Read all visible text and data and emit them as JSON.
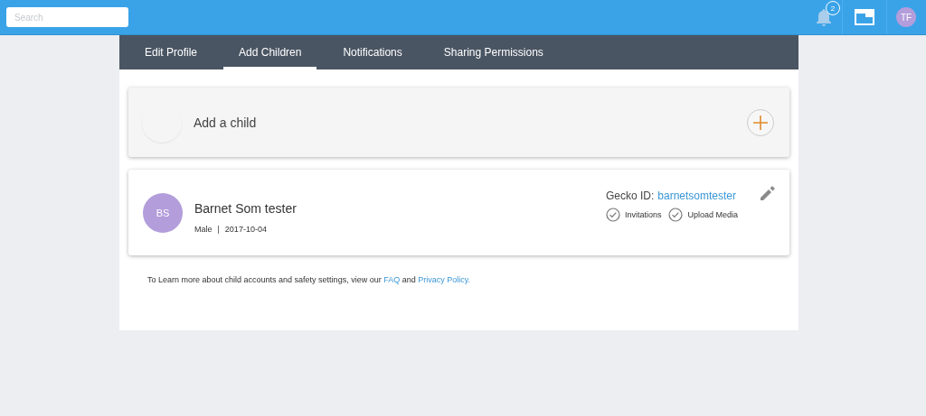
{
  "top_bar": {
    "search": {
      "placeholder": "Search"
    },
    "notifications": {
      "count": "2"
    },
    "user": {
      "initials": "TF"
    }
  },
  "tabs": [
    {
      "label": "Edit Profile",
      "selected": false
    },
    {
      "label": "Add Children",
      "selected": true
    },
    {
      "label": "Notifications",
      "selected": false
    },
    {
      "label": "Sharing Permissions",
      "selected": false
    }
  ],
  "add_child": {
    "label": "Add a child"
  },
  "children": [
    {
      "initials": "BS",
      "name": "Barnet Som tester",
      "gender": "Male",
      "separator": "|",
      "birthdate": "2017-10-04",
      "gecko_id_label": "Gecko ID:",
      "gecko_id": "barnetsomtester",
      "permissions": [
        {
          "label": "Invitations",
          "checked": true
        },
        {
          "label": "Upload Media",
          "checked": true
        }
      ]
    }
  ],
  "footer": [
    {
      "kind": "text",
      "text": "To Learn more about child accounts and safety settings, view our "
    },
    {
      "kind": "link",
      "text": "FAQ"
    },
    {
      "kind": "text",
      "text": " and "
    },
    {
      "kind": "link",
      "text": "Privacy Policy."
    }
  ]
}
